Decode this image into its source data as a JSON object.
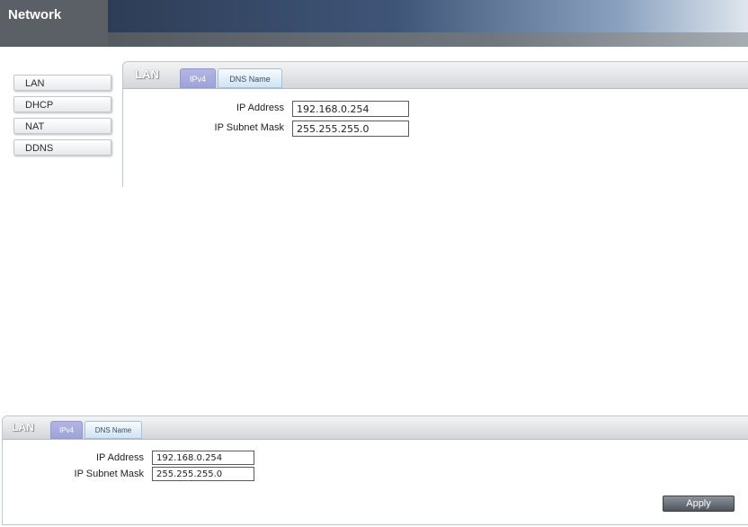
{
  "app": {
    "title": "Network"
  },
  "sidebar": {
    "items": [
      {
        "label": "LAN"
      },
      {
        "label": "DHCP"
      },
      {
        "label": "NAT"
      },
      {
        "label": "DDNS"
      }
    ]
  },
  "panel": {
    "title": "LAN",
    "tabs": [
      {
        "label": "IPv4",
        "active": true
      },
      {
        "label": "DNS Name",
        "active": false
      }
    ],
    "fields": {
      "ip_address": {
        "label": "IP Address",
        "value": "192.168.0.254"
      },
      "subnet_mask": {
        "label": "IP Subnet Mask",
        "value": "255.255.255.0"
      }
    }
  },
  "bottom_panel": {
    "title": "LAN",
    "tabs": [
      {
        "label": "IPv4",
        "active": true
      },
      {
        "label": "DNS Name",
        "active": false
      }
    ],
    "fields": {
      "ip_address": {
        "label": "IP Address",
        "value": "192.168.0.254"
      },
      "subnet_mask": {
        "label": "IP Subnet Mask",
        "value": "255.255.255.0"
      }
    },
    "apply_label": "Apply"
  },
  "colors": {
    "active_tab": "#a3a7dc",
    "inactive_tab": "#d8e8f5",
    "apply_button": "#5c636a",
    "sidebar_header": "#5a6066"
  }
}
